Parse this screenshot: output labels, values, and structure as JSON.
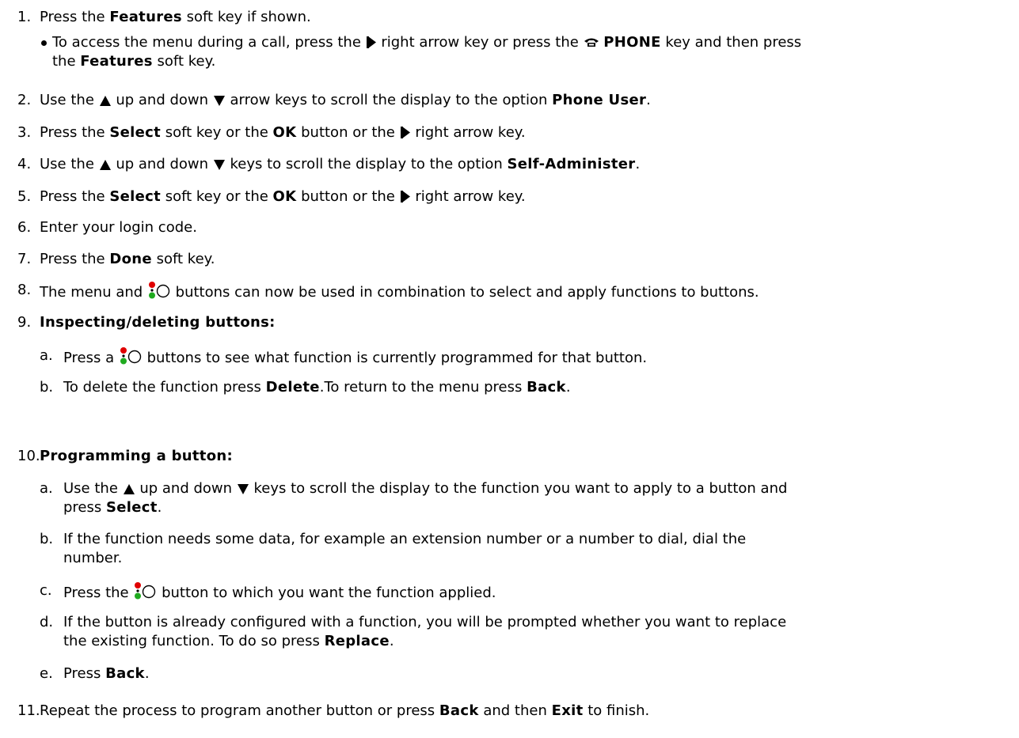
{
  "steps": [
    {
      "num": "1.",
      "segments": [
        {
          "t": "Press the "
        },
        {
          "b": "Features"
        },
        {
          "t": " soft key if shown."
        }
      ]
    },
    {
      "num": "2.",
      "segments": [
        {
          "t": "Use the "
        },
        {
          "icon": "up-arrow-icon"
        },
        {
          "t": " up and down "
        },
        {
          "icon": "down-arrow-icon"
        },
        {
          "t": " arrow keys to scroll the display to the option "
        },
        {
          "b": "Phone User"
        },
        {
          "t": "."
        }
      ]
    },
    {
      "num": "3.",
      "segments": [
        {
          "t": "Press the "
        },
        {
          "b": "Select"
        },
        {
          "t": " soft key or the "
        },
        {
          "b": "OK"
        },
        {
          "t": " button or the "
        },
        {
          "icon": "right-arrow-icon"
        },
        {
          "t": " right arrow key."
        }
      ]
    },
    {
      "num": "4.",
      "segments": [
        {
          "t": "Use the "
        },
        {
          "icon": "up-arrow-icon"
        },
        {
          "t": " up and down  "
        },
        {
          "icon": "down-arrow-icon"
        },
        {
          "t": " keys to scroll the display to the option "
        },
        {
          "b": "Self-Administer"
        },
        {
          "t": "."
        }
      ]
    },
    {
      "num": "5.",
      "segments": [
        {
          "t": "Press the "
        },
        {
          "b": "Select"
        },
        {
          "t": " soft key or the "
        },
        {
          "b": "OK"
        },
        {
          "t": " button or the "
        },
        {
          "icon": "right-arrow-icon"
        },
        {
          "t": " right arrow key."
        }
      ]
    },
    {
      "num": "6.",
      "segments": [
        {
          "t": "Enter your login code."
        }
      ]
    },
    {
      "num": "7.",
      "segments": [
        {
          "t": "Press the "
        },
        {
          "b": "Done"
        },
        {
          "t": " soft key."
        }
      ]
    },
    {
      "num": "8.",
      "segments": [
        {
          "t": "The menu and "
        },
        {
          "icon": "button-lamp-icon"
        },
        {
          "t": " buttons can now be used in combination to select and apply functions to buttons."
        }
      ]
    },
    {
      "num": "9.",
      "segments": [
        {
          "b": "Inspecting/deleting buttons:"
        }
      ]
    },
    {
      "num": "10.",
      "segments": [
        {
          "b": "Programming a button:"
        }
      ]
    },
    {
      "num": "11.",
      "segments": [
        {
          "t": "Repeat the process to program another button or press "
        },
        {
          "b": "Back"
        },
        {
          "t": " and then "
        },
        {
          "b": "Exit"
        },
        {
          "t": " to finish."
        }
      ]
    }
  ],
  "bullet_lines": [
    [
      {
        "t": "To access the menu during a call, press the "
      },
      {
        "icon": "right-arrow-icon"
      },
      {
        "t": " right arrow key or press the "
      },
      {
        "icon": "phone-icon"
      },
      {
        "t": " "
      },
      {
        "b": "PHONE"
      },
      {
        "t": " key and then press"
      }
    ],
    [
      {
        "t": "the "
      },
      {
        "b": "Features"
      },
      {
        "t": " soft key."
      }
    ]
  ],
  "sub_steps": [
    {
      "letter": "a.",
      "lines": [
        [
          {
            "t": "Press a  "
          },
          {
            "icon": "button-lamp-icon"
          },
          {
            "t": " buttons to see what function is currently programmed for that button."
          }
        ]
      ]
    },
    {
      "letter": "b.",
      "lines": [
        [
          {
            "t": "To delete the function press "
          },
          {
            "b": "Delete"
          },
          {
            "t": ".To return to the menu press "
          },
          {
            "b": "Back"
          },
          {
            "t": "."
          }
        ]
      ]
    },
    {
      "letter": "a.",
      "lines": [
        [
          {
            "t": "Use the "
          },
          {
            "icon": "up-arrow-icon"
          },
          {
            "t": " up and down  "
          },
          {
            "icon": "down-arrow-icon"
          },
          {
            "t": " keys to scroll the display to the function you want to apply to a button and"
          }
        ],
        [
          {
            "t": "press "
          },
          {
            "b": "Select"
          },
          {
            "t": "."
          }
        ]
      ]
    },
    {
      "letter": "b.",
      "lines": [
        [
          {
            "t": "If the function needs some data, for example an extension number or a number to dial, dial the"
          }
        ],
        [
          {
            "t": "number."
          }
        ]
      ]
    },
    {
      "letter": "c.",
      "lines": [
        [
          {
            "t": "Press the "
          },
          {
            "icon": "button-lamp-icon"
          },
          {
            "t": " button to which you want the function applied."
          }
        ]
      ]
    },
    {
      "letter": "d.",
      "lines": [
        [
          {
            "t": "If the button is already configured with a function, you will be prompted whether you want to replace"
          }
        ],
        [
          {
            "t": "the existing function. To do so press "
          },
          {
            "b": "Replace"
          },
          {
            "t": "."
          }
        ]
      ]
    },
    {
      "letter": "e.",
      "lines": [
        [
          {
            "t": "Press "
          },
          {
            "b": "Back"
          },
          {
            "t": "."
          }
        ]
      ]
    }
  ],
  "icon_colors": {
    "lamp_red": "#e00000",
    "lamp_green": "#1faa1f"
  }
}
